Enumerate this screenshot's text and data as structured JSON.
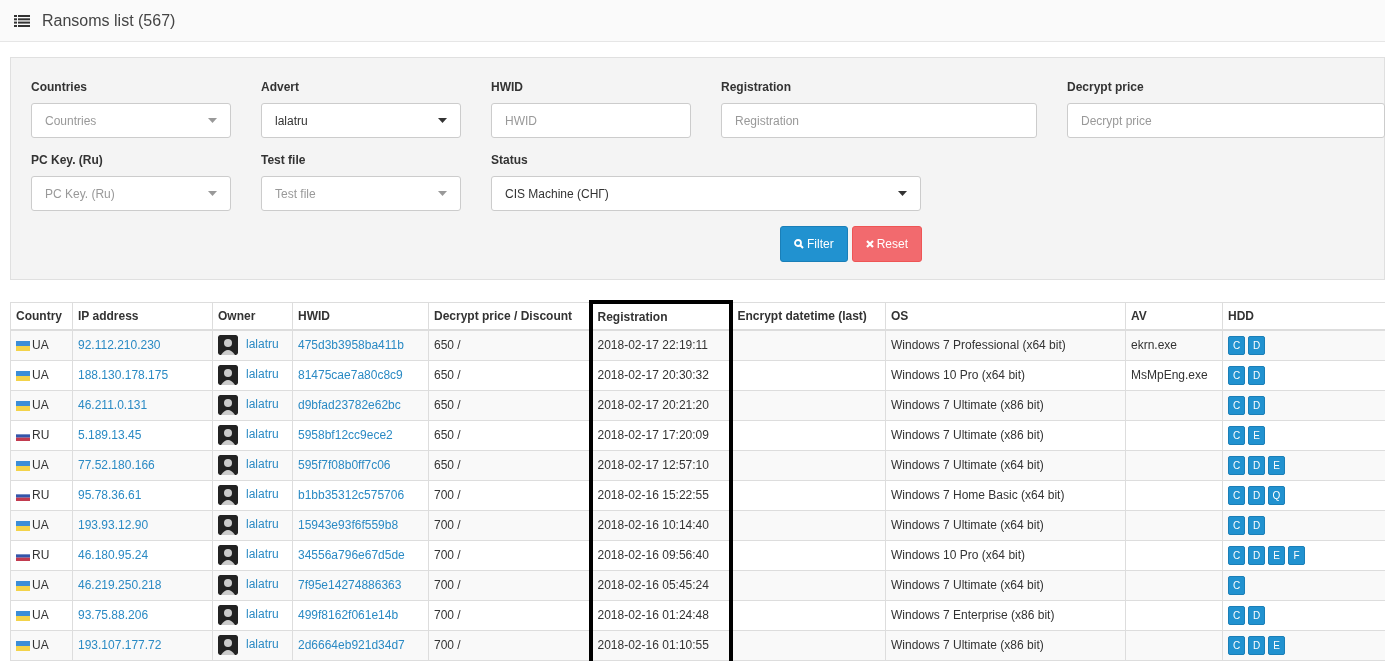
{
  "header": {
    "title": "Ransoms list (567)"
  },
  "filters": [
    {
      "kind": "select",
      "label": "Countries",
      "placeholder": "Countries"
    },
    {
      "kind": "select",
      "label": "Advert",
      "value": "lalatru"
    },
    {
      "kind": "input",
      "label": "HWID",
      "placeholder": "HWID"
    },
    {
      "kind": "input",
      "label": "Registration",
      "placeholder": "Registration"
    },
    {
      "kind": "input",
      "label": "Decrypt price",
      "placeholder": "Decrypt price"
    },
    {
      "kind": "select",
      "label": "PC Key. (Ru)",
      "placeholder": "PC Key. (Ru)"
    },
    {
      "kind": "select",
      "label": "Test file",
      "placeholder": "Test file"
    },
    {
      "kind": "select",
      "label": "Status",
      "value": "CIS Machine (СНГ)"
    }
  ],
  "buttons": [
    {
      "kind": "filter",
      "label": "Filter"
    },
    {
      "kind": "reset",
      "label": "Reset"
    }
  ],
  "table": {
    "columns": [
      {
        "label": "Country",
        "highlighted": false
      },
      {
        "label": "IP address",
        "highlighted": false
      },
      {
        "label": "Owner",
        "highlighted": false
      },
      {
        "label": "HWID",
        "highlighted": false
      },
      {
        "label": "Decrypt price / Discount",
        "highlighted": false
      },
      {
        "label": "Registration",
        "highlighted": true
      },
      {
        "label": "Encrypt datetime (last)",
        "highlighted": false
      },
      {
        "label": "OS",
        "highlighted": false
      },
      {
        "label": "AV",
        "highlighted": false
      },
      {
        "label": "HDD",
        "highlighted": false
      }
    ],
    "rows": [
      {
        "kind": "ua",
        "country": "UA",
        "ip": "92.112.210.230",
        "owner": "lalatru",
        "hwid": "475d3b3958ba411b",
        "price": "650 /",
        "registration": "2018-02-17 22:19:11",
        "os": "Windows 7 Professional (x64 bit)",
        "av": "ekrn.exe",
        "hdd": [
          "C",
          "D"
        ]
      },
      {
        "kind": "ua",
        "country": "UA",
        "ip": "188.130.178.175",
        "owner": "lalatru",
        "hwid": "81475cae7a80c8c9",
        "price": "650 /",
        "registration": "2018-02-17 20:30:32",
        "os": "Windows 10 Pro (x64 bit)",
        "av": "MsMpEng.exe",
        "hdd": [
          "C",
          "D"
        ]
      },
      {
        "kind": "ua",
        "country": "UA",
        "ip": "46.211.0.131",
        "owner": "lalatru",
        "hwid": "d9bfad23782e62bc",
        "price": "650 /",
        "registration": "2018-02-17 20:21:20",
        "os": "Windows 7 Ultimate (x86 bit)",
        "hdd": [
          "C",
          "D"
        ]
      },
      {
        "kind": "ru",
        "country": "RU",
        "ip": "5.189.13.45",
        "owner": "lalatru",
        "hwid": "5958bf12cc9ece2",
        "price": "650 /",
        "registration": "2018-02-17 17:20:09",
        "os": "Windows 7 Ultimate (x86 bit)",
        "hdd": [
          "C",
          "E"
        ]
      },
      {
        "kind": "ua",
        "country": "UA",
        "ip": "77.52.180.166",
        "owner": "lalatru",
        "hwid": "595f7f08b0ff7c06",
        "price": "650 /",
        "registration": "2018-02-17 12:57:10",
        "os": "Windows 7 Ultimate (x64 bit)",
        "hdd": [
          "C",
          "D",
          "E"
        ]
      },
      {
        "kind": "ru",
        "country": "RU",
        "ip": "95.78.36.61",
        "owner": "lalatru",
        "hwid": "b1bb35312c575706",
        "price": "700 /",
        "registration": "2018-02-16 15:22:55",
        "os": "Windows 7 Home Basic (x64 bit)",
        "hdd": [
          "C",
          "D",
          "Q"
        ]
      },
      {
        "kind": "ua",
        "country": "UA",
        "ip": "193.93.12.90",
        "owner": "lalatru",
        "hwid": "15943e93f6f559b8",
        "price": "700 /",
        "registration": "2018-02-16 10:14:40",
        "os": "Windows 7 Ultimate (x64 bit)",
        "hdd": [
          "C",
          "D"
        ]
      },
      {
        "kind": "ru",
        "country": "RU",
        "ip": "46.180.95.24",
        "owner": "lalatru",
        "hwid": "34556a796e67d5de",
        "price": "700 /",
        "registration": "2018-02-16 09:56:40",
        "os": "Windows 10 Pro (x64 bit)",
        "hdd": [
          "C",
          "D",
          "E",
          "F"
        ]
      },
      {
        "kind": "ua",
        "country": "UA",
        "ip": "46.219.250.218",
        "owner": "lalatru",
        "hwid": "7f95e14274886363",
        "price": "700 /",
        "registration": "2018-02-16 05:45:24",
        "os": "Windows 7 Ultimate (x64 bit)",
        "hdd": [
          "C"
        ]
      },
      {
        "kind": "ua",
        "country": "UA",
        "ip": "93.75.88.206",
        "owner": "lalatru",
        "hwid": "499f8162f061e14b",
        "price": "700 /",
        "registration": "2018-02-16 01:24:48",
        "os": "Windows 7 Enterprise (x86 bit)",
        "hdd": [
          "C",
          "D"
        ]
      },
      {
        "kind": "ua",
        "country": "UA",
        "ip": "193.107.177.72",
        "owner": "lalatru",
        "hwid": "2d6664eb921d34d7",
        "price": "700 /",
        "registration": "2018-02-16 01:10:55",
        "os": "Windows 7 Ultimate (x86 bit)",
        "hdd": [
          "C",
          "D",
          "E"
        ]
      }
    ]
  }
}
